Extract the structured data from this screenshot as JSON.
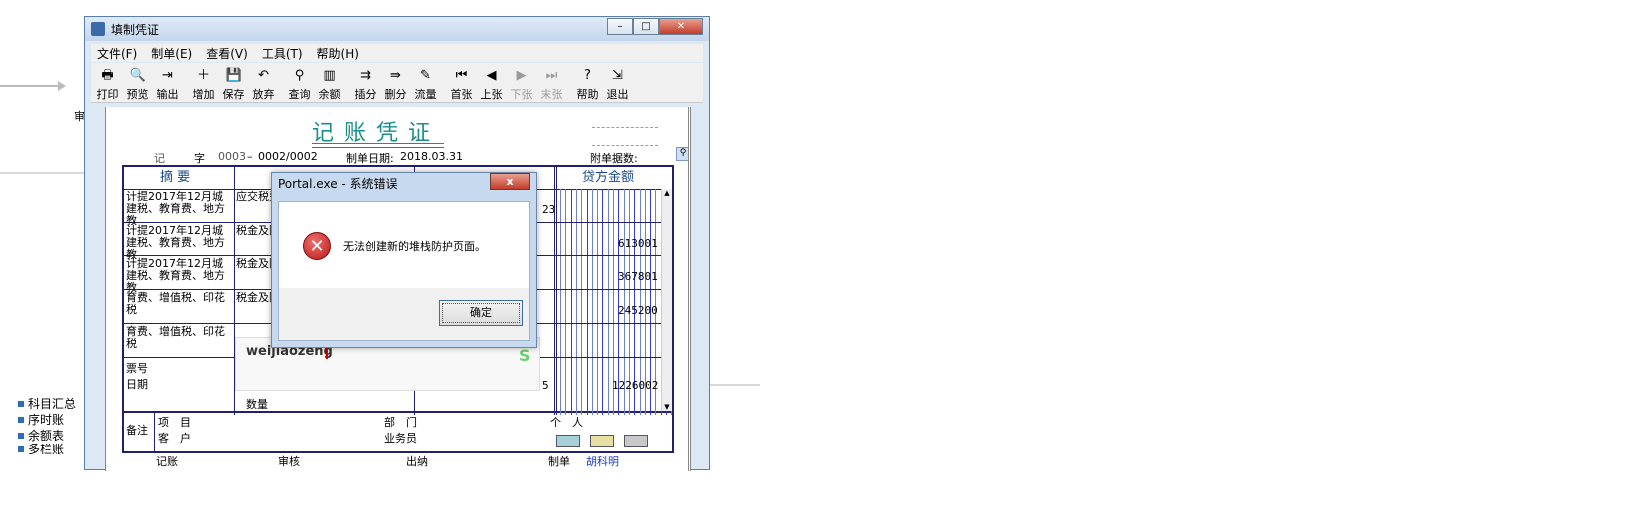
{
  "window": {
    "title": "填制凭证"
  },
  "menu": [
    "文件(F)",
    "制单(E)",
    "查看(V)",
    "工具(T)",
    "帮助(H)"
  ],
  "toolbar": [
    {
      "label": "打印",
      "icon": "printer-icon",
      "glyph": "🖶",
      "enabled": true
    },
    {
      "label": "预览",
      "icon": "preview-icon",
      "glyph": "🔍",
      "enabled": true
    },
    {
      "label": "输出",
      "icon": "export-icon",
      "glyph": "⇥",
      "enabled": true
    },
    {
      "label": "增加",
      "icon": "add-icon",
      "glyph": "＋",
      "enabled": true
    },
    {
      "label": "保存",
      "icon": "save-icon",
      "glyph": "💾",
      "enabled": true
    },
    {
      "label": "放弃",
      "icon": "undo-icon",
      "glyph": "↶",
      "enabled": true
    },
    {
      "label": "查询",
      "icon": "binoculars-icon",
      "glyph": "⚲",
      "enabled": true
    },
    {
      "label": "余额",
      "icon": "balance-chart-icon",
      "glyph": "▥",
      "enabled": true
    },
    {
      "label": "插分",
      "icon": "insert-line-icon",
      "glyph": "⇉",
      "enabled": true
    },
    {
      "label": "删分",
      "icon": "delete-line-icon",
      "glyph": "⇛",
      "enabled": true
    },
    {
      "label": "流量",
      "icon": "cashflow-icon",
      "glyph": "✎",
      "enabled": true
    },
    {
      "label": "首张",
      "icon": "first-page-icon",
      "glyph": "⏮",
      "enabled": true
    },
    {
      "label": "上张",
      "icon": "previous-page-icon",
      "glyph": "◀",
      "enabled": true
    },
    {
      "label": "下张",
      "icon": "next-page-icon",
      "glyph": "▶",
      "enabled": false
    },
    {
      "label": "末张",
      "icon": "last-page-icon",
      "glyph": "⏭",
      "enabled": false
    },
    {
      "label": "帮助",
      "icon": "help-icon",
      "glyph": "?",
      "enabled": true
    },
    {
      "label": "退出",
      "icon": "exit-icon",
      "glyph": "⇲",
      "enabled": true
    }
  ],
  "voucher": {
    "title": "记账凭证",
    "type_label": "记",
    "zi": "字",
    "number": "0003",
    "page": "0002/0002",
    "date_label": "制单日期:",
    "date": "2018.03.31",
    "attach_label": "附单据数:",
    "col_summary": "摘 要",
    "col_credit": "贷方金额",
    "rows": [
      {
        "summary": "计提2017年12月城建税、教育费、地方教",
        "account": "应交税费",
        "debit": "23",
        "credit": ""
      },
      {
        "summary": "计提2017年12月城建税、教育费、地方教",
        "account": "税金及附",
        "debit": "",
        "credit": "613001"
      },
      {
        "summary": "计提2017年12月城建税、教育费、地方教",
        "account": "税金及附",
        "debit": "",
        "credit": "367801"
      },
      {
        "summary": "育费、增值税、印花税",
        "account": "税金及附",
        "debit": "",
        "credit": "245200"
      },
      {
        "summary": "育费、增值税、印花税",
        "account": "",
        "debit": "",
        "credit": ""
      }
    ],
    "ticket_label": "票号",
    "date_row_label": "日期",
    "quantity_label": "数量",
    "total_debit": "5",
    "total_credit": "1226002",
    "notes_label": "备注",
    "project_label": "项　目",
    "dept_label": "部　门",
    "person_label": "个　人",
    "customer_label": "客　户",
    "salesman_label": "业务员",
    "bookkeep_label": "记账",
    "audit_label": "审核",
    "cashier_label": "出纳",
    "maker_label": "制单",
    "maker_name": "胡科明"
  },
  "dialog": {
    "title": "Portal.exe - 系统错误",
    "message": "无法创建新的堆栈防护页面。",
    "ok": "确定",
    "close": "x"
  },
  "ime": {
    "text": "weijiaozeng",
    "logo": "S"
  },
  "left_nav": [
    "科目汇总",
    "序时账",
    "余额表",
    "多栏账"
  ],
  "background_fragment": "审"
}
